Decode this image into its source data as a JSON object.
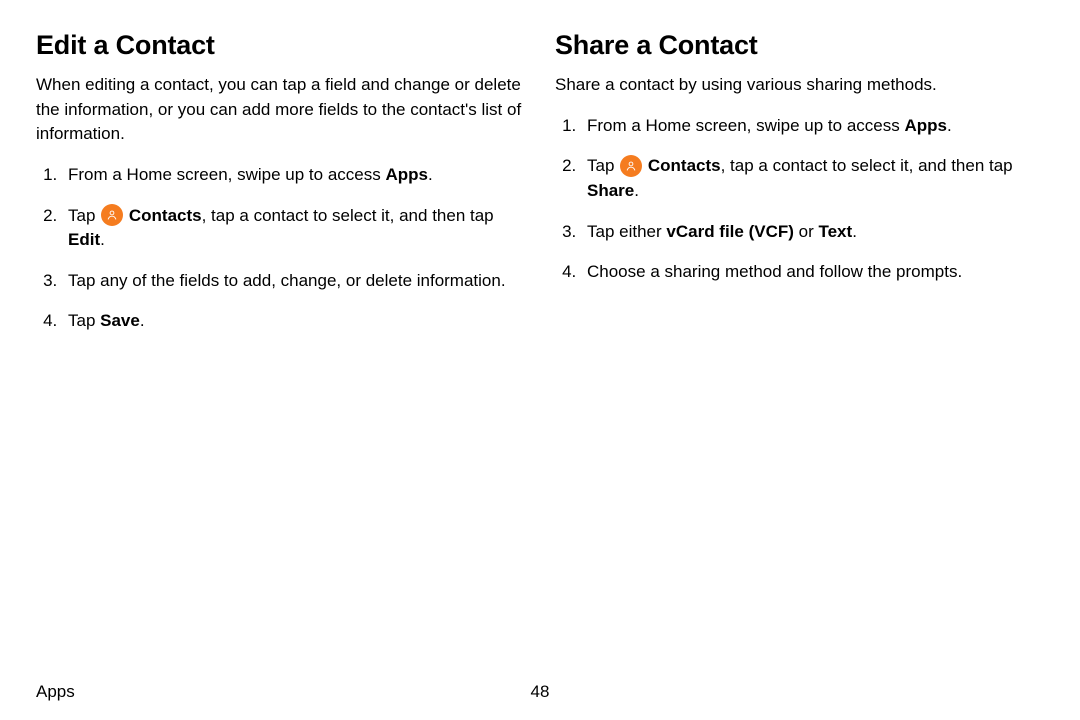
{
  "left": {
    "heading": "Edit a Contact",
    "intro": "When editing a contact, you can tap a field and change or delete the information, or you can add more fields to the contact's list of information.",
    "steps": [
      {
        "pre": "From a Home screen, swipe up to access ",
        "bold": "Apps",
        "post": "."
      },
      {
        "pre": "Tap ",
        "icon": true,
        "bold1": "Contacts",
        "mid": ", tap a contact to select it, and then tap ",
        "bold2": "Edit",
        "post": "."
      },
      {
        "pre": "Tap any of the fields to add, change, or delete information."
      },
      {
        "pre": "Tap ",
        "bold": "Save",
        "post": "."
      }
    ]
  },
  "right": {
    "heading": "Share a Contact",
    "intro": "Share a contact by using various sharing methods.",
    "steps": [
      {
        "pre": "From a Home screen, swipe up to access ",
        "bold": "Apps",
        "post": "."
      },
      {
        "pre": "Tap ",
        "icon": true,
        "bold1": "Contacts",
        "mid": ", tap a contact to select it, and then tap ",
        "bold2": "Share",
        "post": "."
      },
      {
        "pre": "Tap either ",
        "bold": "vCard file (VCF)",
        "mid": " or ",
        "bold2": "Text",
        "post": "."
      },
      {
        "pre": "Choose a sharing method and follow the prompts."
      }
    ]
  },
  "footer": {
    "section": "Apps",
    "page": "48"
  }
}
